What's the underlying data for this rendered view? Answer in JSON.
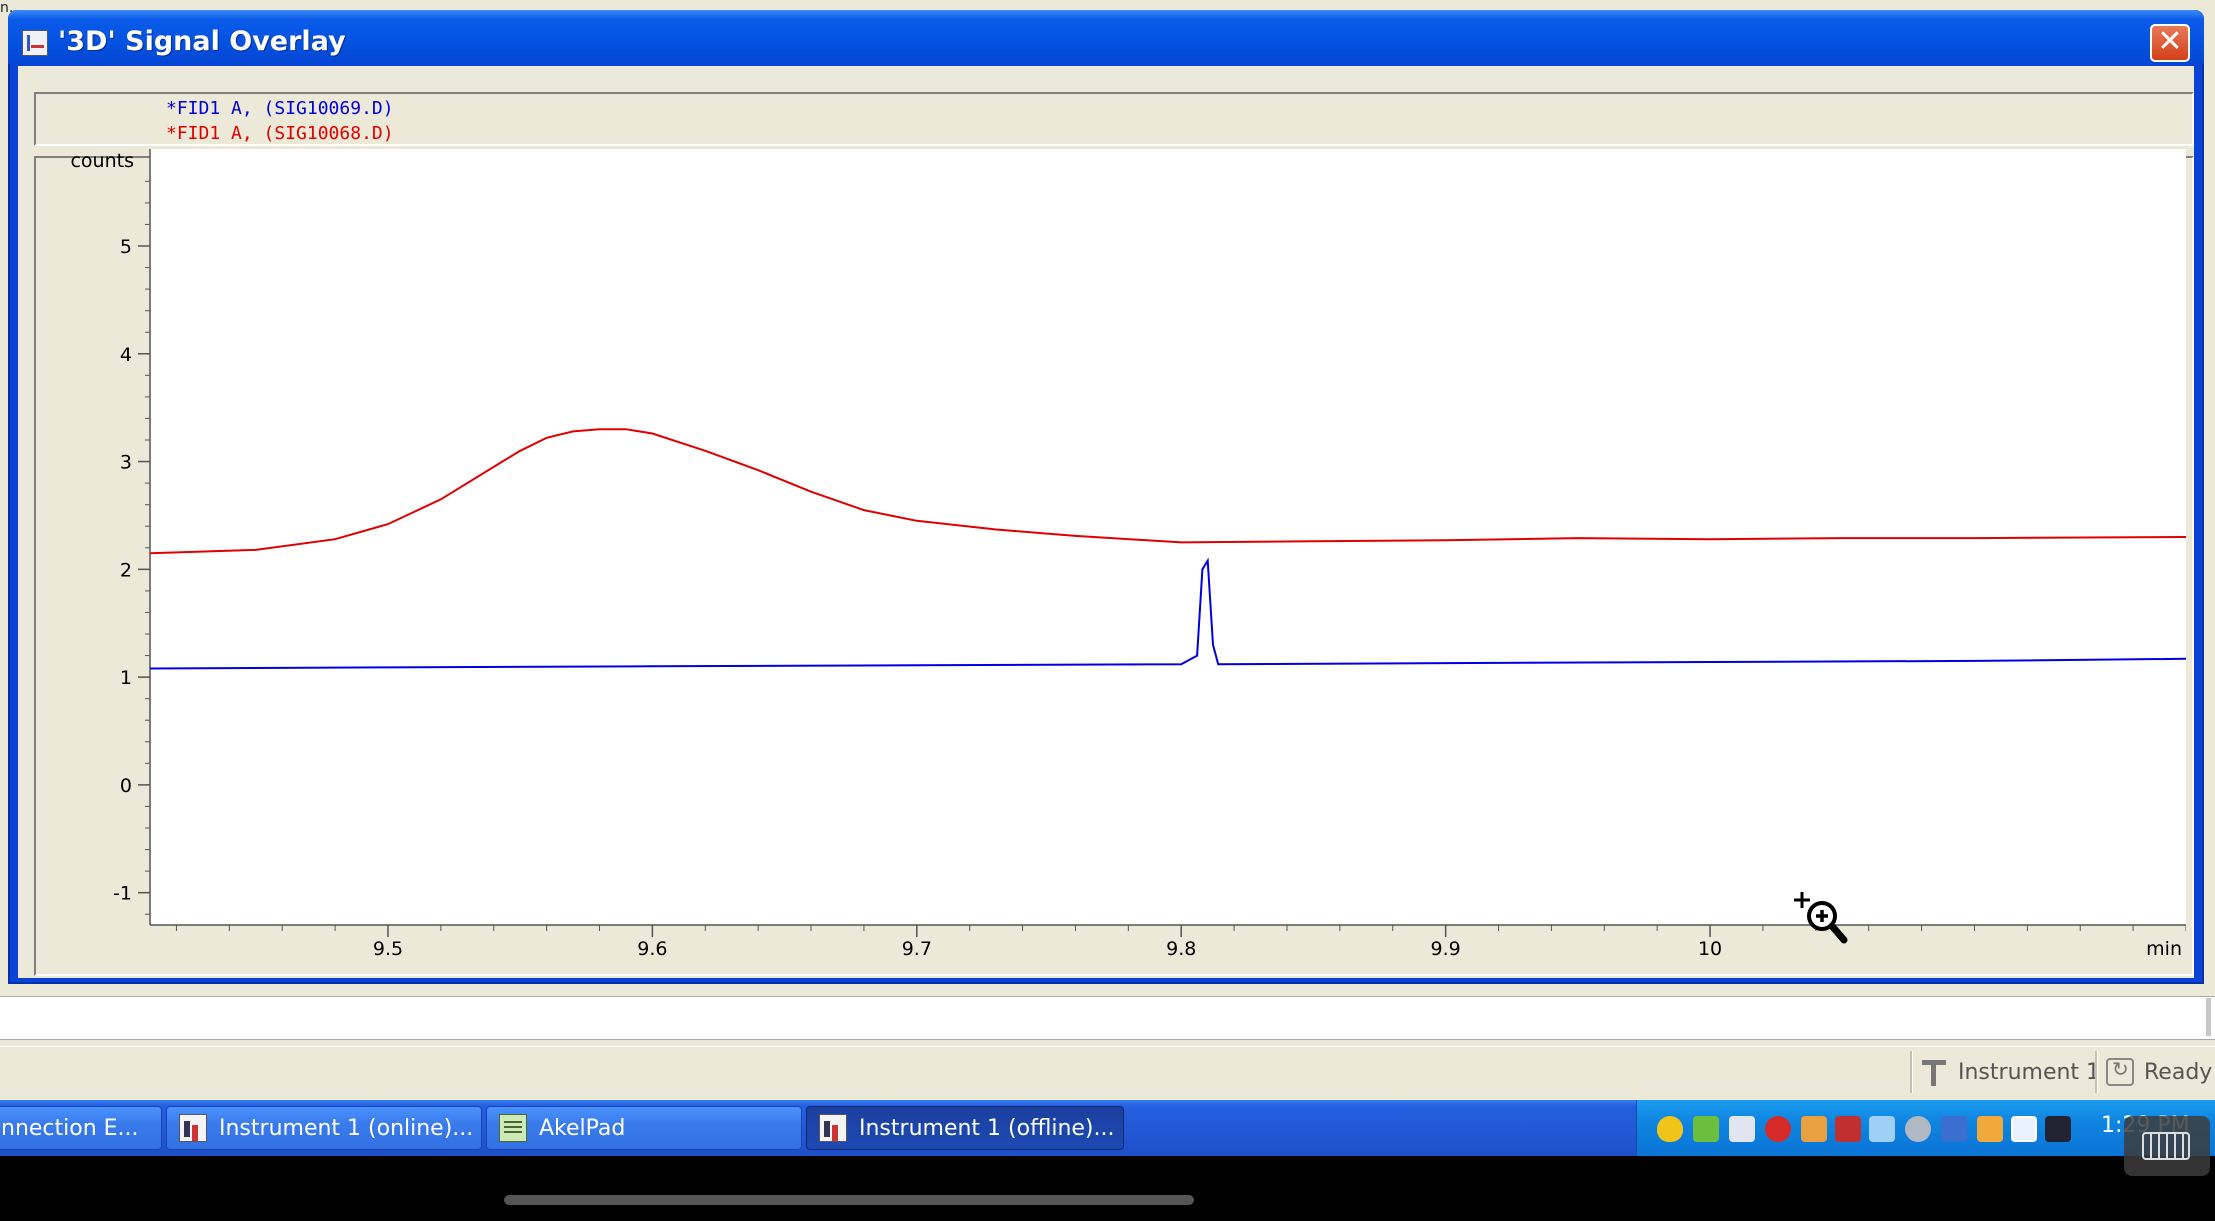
{
  "background": {
    "top_label": "n...",
    "edge_fragment": "0"
  },
  "window": {
    "title": "'3D' Signal Overlay",
    "close_label": "✕"
  },
  "legend": [
    {
      "label": "*FID1 A, (SIG10069.D)",
      "color": "#0000e0"
    },
    {
      "label": "*FID1 A, (SIG10068.D)",
      "color": "#e00000"
    }
  ],
  "chart_data": {
    "type": "line",
    "ylabel": "counts",
    "xlabel": "min",
    "xlim": [
      9.41,
      10.18
    ],
    "ylim": [
      -1.3,
      5.9
    ],
    "x_ticks": [
      9.5,
      9.6,
      9.7,
      9.8,
      9.9,
      10
    ],
    "x_tick_labels": [
      "9.5",
      "9.6",
      "9.7",
      "9.8",
      "9.9",
      "10"
    ],
    "y_ticks": [
      -1,
      0,
      1,
      2,
      3,
      4,
      5
    ],
    "y_tick_labels": [
      "-1",
      "0",
      "1",
      "2",
      "3",
      "4",
      "5"
    ],
    "series": [
      {
        "name": "*FID1 A, (SIG10068.D)",
        "color": "#e00000",
        "x": [
          9.41,
          9.45,
          9.48,
          9.5,
          9.52,
          9.54,
          9.55,
          9.56,
          9.57,
          9.58,
          9.59,
          9.6,
          9.62,
          9.64,
          9.66,
          9.68,
          9.7,
          9.73,
          9.76,
          9.8,
          9.85,
          9.9,
          9.95,
          10.0,
          10.05,
          10.1,
          10.18
        ],
        "y": [
          2.15,
          2.18,
          2.28,
          2.42,
          2.65,
          2.95,
          3.1,
          3.22,
          3.28,
          3.3,
          3.3,
          3.26,
          3.1,
          2.92,
          2.72,
          2.55,
          2.45,
          2.37,
          2.31,
          2.25,
          2.26,
          2.27,
          2.29,
          2.28,
          2.29,
          2.29,
          2.3
        ]
      },
      {
        "name": "*FID1 A, (SIG10069.D)",
        "color": "#0000e0",
        "x": [
          9.41,
          9.5,
          9.6,
          9.7,
          9.8,
          9.806,
          9.808,
          9.81,
          9.812,
          9.814,
          9.9,
          10.0,
          10.1,
          10.18
        ],
        "y": [
          1.08,
          1.09,
          1.1,
          1.11,
          1.12,
          1.2,
          2.0,
          2.08,
          1.3,
          1.12,
          1.13,
          1.14,
          1.15,
          1.17
        ]
      }
    ]
  },
  "status_bar": {
    "instrument": "Instrument 1",
    "state": "Ready"
  },
  "taskbar": {
    "buttons": [
      {
        "label": "nnection E...",
        "icon": "window-icon",
        "active": false
      },
      {
        "label": "Instrument 1 (online)...",
        "icon": "chemstation-online-icon",
        "active": false
      },
      {
        "label": "AkelPad",
        "icon": "notepad-icon",
        "active": false
      },
      {
        "label": "Instrument 1 (offline)...",
        "icon": "chemstation-offline-icon",
        "active": true
      }
    ],
    "tray_icons": [
      "shield-icon",
      "network-icon",
      "computer-icon",
      "antivirus-icon",
      "volume-icon",
      "connection-error-icon",
      "wireless-icon",
      "sync-icon",
      "language-icon",
      "folder-icon",
      "display-icon",
      "monitor-icon"
    ],
    "clock": "1:29 PM"
  }
}
